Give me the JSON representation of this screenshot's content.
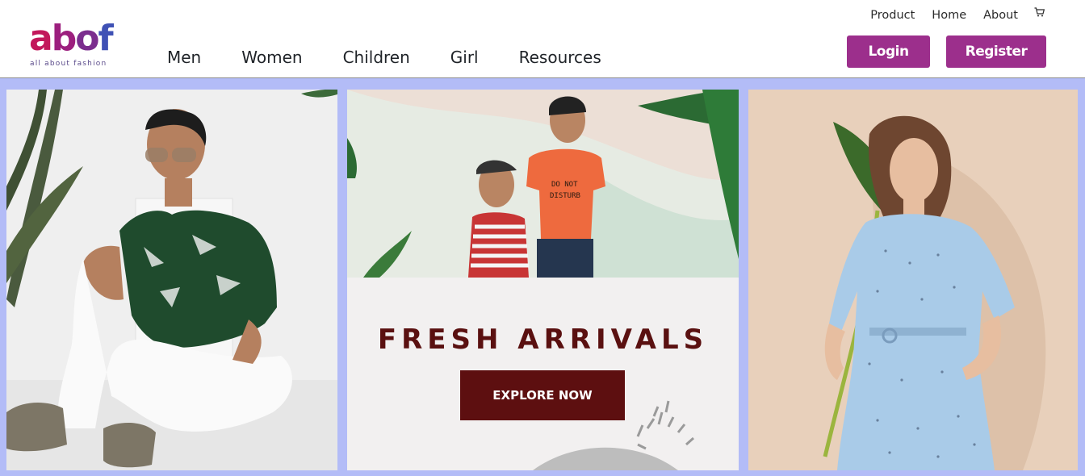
{
  "brand": {
    "logo_text": "abof",
    "tagline": "all about fashion"
  },
  "top_nav": {
    "items": [
      {
        "label": "Product"
      },
      {
        "label": "Home"
      },
      {
        "label": "About"
      }
    ],
    "cart_icon": "cart-icon"
  },
  "main_nav": {
    "items": [
      {
        "label": "Men"
      },
      {
        "label": "Women"
      },
      {
        "label": "Children"
      },
      {
        "label": "Girl"
      },
      {
        "label": "Resources"
      }
    ]
  },
  "auth": {
    "login_label": "Login",
    "register_label": "Register"
  },
  "banner": {
    "headline": "FRESH ARRIVALS",
    "cta_label": "EXPLORE NOW",
    "kid_shirt_text_line1": "DO NOT",
    "kid_shirt_text_line2": "DISTURB"
  },
  "colors": {
    "accent": "#9c2f8c",
    "banner_bg": "#b3bcf7",
    "headline": "#5a1010",
    "cta_bg": "#5d0f10"
  }
}
